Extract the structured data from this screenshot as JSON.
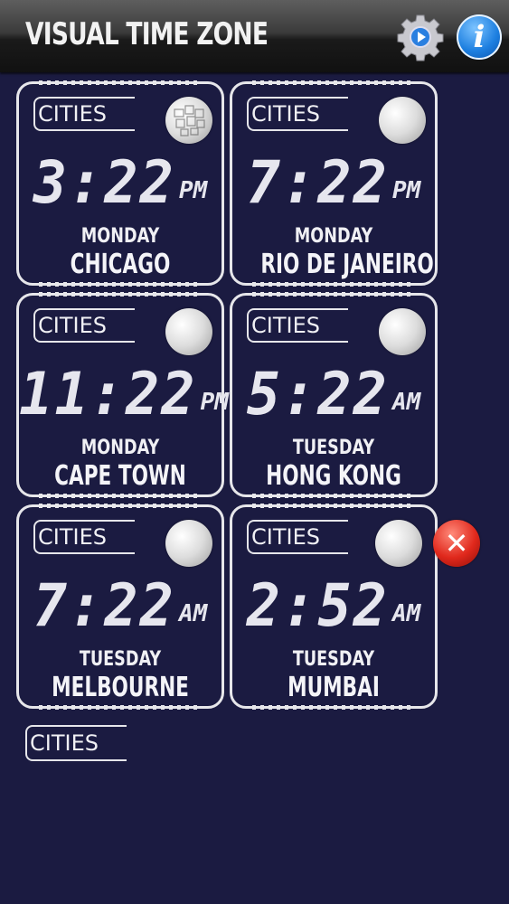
{
  "app": {
    "title": "VISUAL TIME ZONE"
  },
  "toolbar": {
    "settings_icon": "gear-icon",
    "info_icon": "info-icon",
    "info_glyph": "i"
  },
  "colors": {
    "background": "#1b1b41",
    "accent_info": "#1d7fe0",
    "accent_close": "#e0281c",
    "line": "#e6e6ea"
  },
  "cards": [
    {
      "tab": "CITIES",
      "time": "3:22",
      "ampm": "PM",
      "day": "MONDAY",
      "city": "CHICAGO"
    },
    {
      "tab": "CITIES",
      "time": "7:22",
      "ampm": "PM",
      "day": "MONDAY",
      "city": "RIO DE JANEIRO"
    },
    {
      "tab": "CITIES",
      "time": "11:22",
      "ampm": "PM",
      "day": "MONDAY",
      "city": "CAPE TOWN"
    },
    {
      "tab": "CITIES",
      "time": "5:22",
      "ampm": "AM",
      "day": "TUESDAY",
      "city": "HONG KONG"
    },
    {
      "tab": "CITIES",
      "time": "7:22",
      "ampm": "AM",
      "day": "TUESDAY",
      "city": "MELBOURNE"
    },
    {
      "tab": "CITIES",
      "time": "2:52",
      "ampm": "AM",
      "day": "TUESDAY",
      "city": "MUMBAI"
    }
  ],
  "close": {
    "glyph": "✕"
  },
  "add_slot": {
    "tab": "CITIES"
  }
}
